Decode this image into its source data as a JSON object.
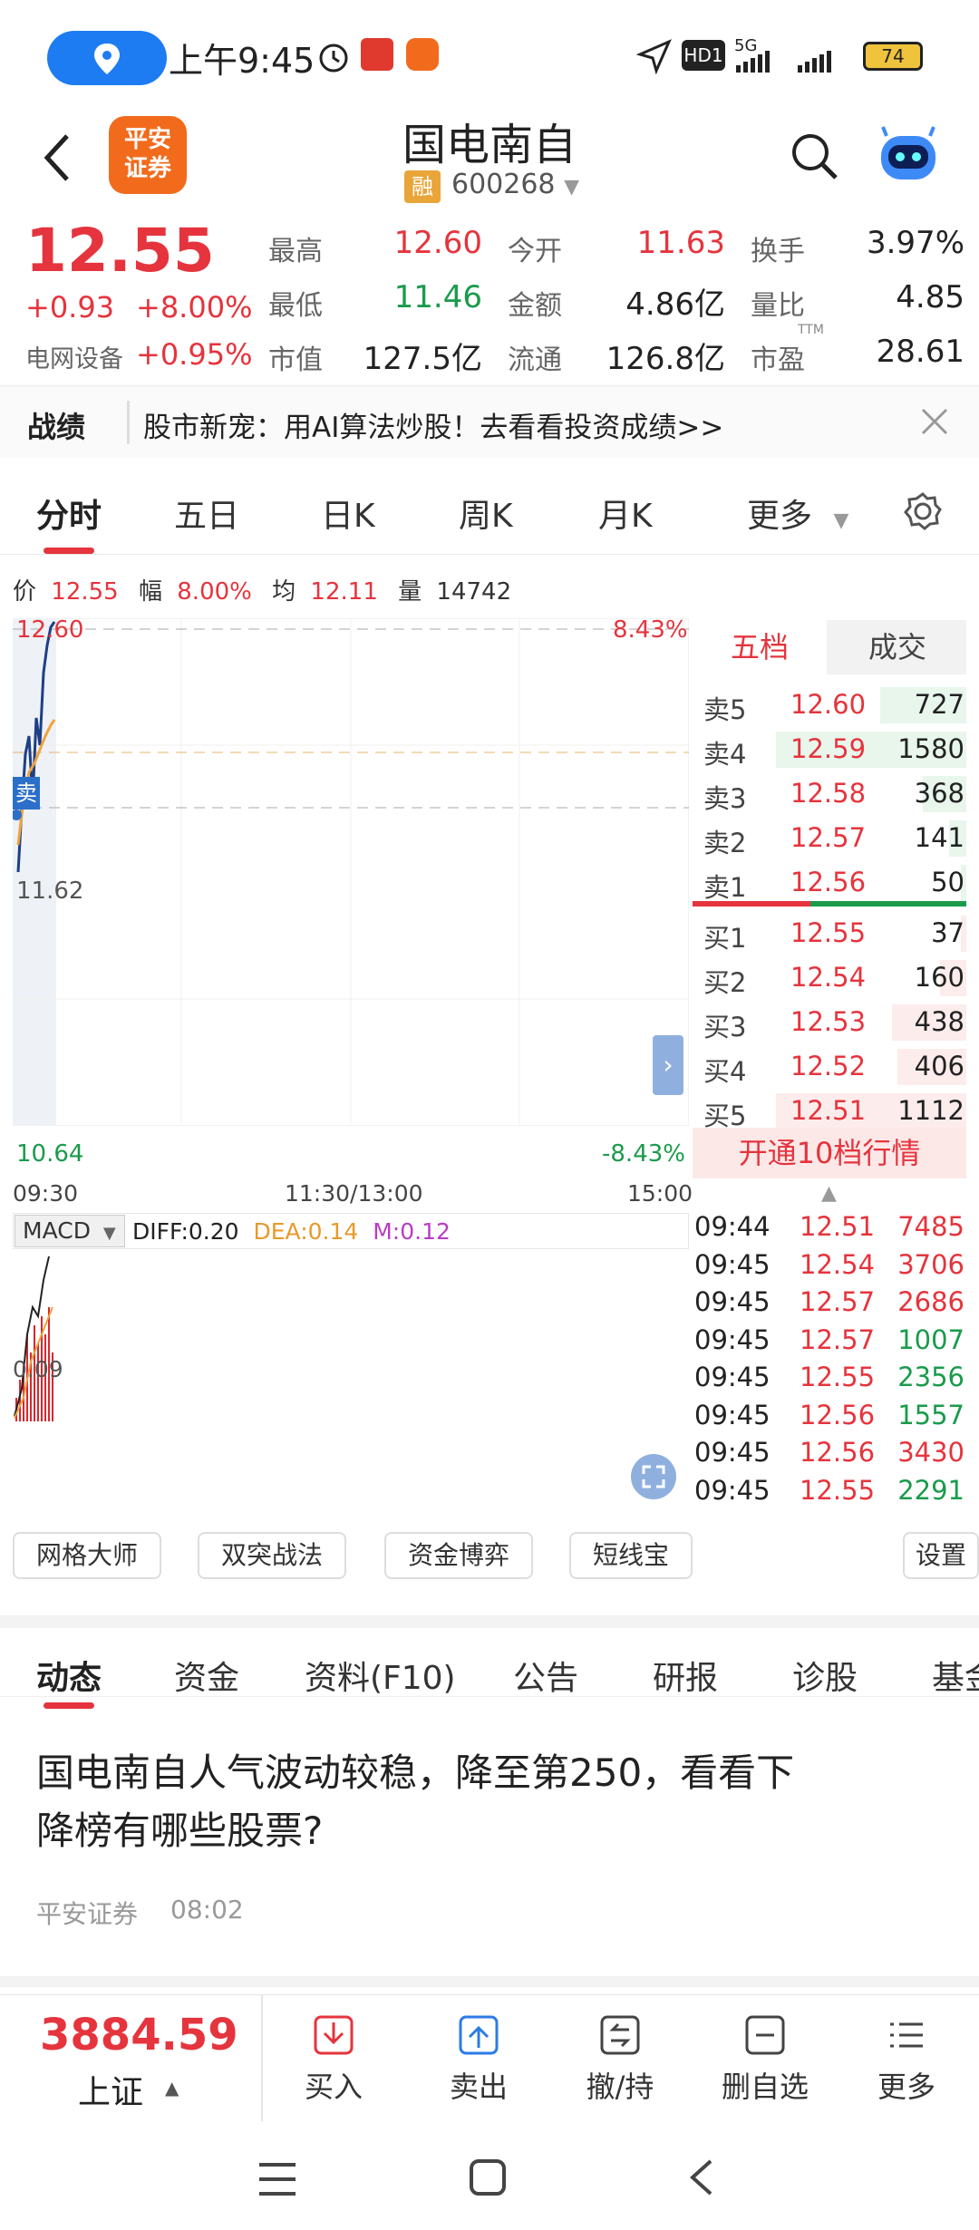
{
  "status_bar": {
    "time": "上午9:45",
    "hd": "HD1",
    "network": "5G",
    "battery": "74"
  },
  "header": {
    "logo_text_line1": "平安",
    "logo_text_line2": "证券",
    "stock_name": "国电南自",
    "margin_badge": "融",
    "stock_code": "600268"
  },
  "quote": {
    "price": "12.55",
    "change": "+0.93",
    "change_pct": "+8.00%",
    "sector": "电网设备",
    "sector_pct": "+0.95%",
    "fields": [
      {
        "label": "最高",
        "value": "12.60",
        "tone": "red"
      },
      {
        "label": "今开",
        "value": "11.63",
        "tone": "red"
      },
      {
        "label": "换手",
        "value": "3.97%",
        "tone": "dark"
      },
      {
        "label": "最低",
        "value": "11.46",
        "tone": "green"
      },
      {
        "label": "金额",
        "value": "4.86亿",
        "tone": "dark"
      },
      {
        "label": "量比",
        "value": "4.85",
        "tone": "dark"
      },
      {
        "label": "市值",
        "value": "127.5亿",
        "tone": "dark"
      },
      {
        "label": "流通",
        "value": "126.8亿",
        "tone": "dark"
      },
      {
        "label": "市盈",
        "value": "28.61",
        "tone": "dark"
      }
    ],
    "ttm": "TTM"
  },
  "banner": {
    "tag": "战绩",
    "text": "股市新宠：用AI算法炒股！去看看投资成绩>>"
  },
  "chart_tabs": [
    "分时",
    "五日",
    "日K",
    "周K",
    "月K",
    "更多"
  ],
  "intraday": {
    "info": {
      "price_label": "价",
      "price": "12.55",
      "range_label": "幅",
      "range": "8.00%",
      "avg_label": "均",
      "avg": "12.11",
      "vol_label": "量",
      "vol": "14742"
    },
    "y_top": "12.60",
    "y_mid": "11.62",
    "y_bottom": "10.64",
    "pct_top": "8.43%",
    "pct_bottom": "-8.43%",
    "sell_tag": "卖",
    "x_start": "09:30",
    "x_mid": "11:30/13:00",
    "x_end": "15:00"
  },
  "macd": {
    "label": "MACD",
    "diff": "DIFF:0.20",
    "dea": "DEA:0.14",
    "m": "M:0.12",
    "level": "0.09"
  },
  "order_book": {
    "tabs": [
      "五档",
      "成交"
    ],
    "asks": [
      {
        "label": "卖5",
        "price": "12.60",
        "vol": "727",
        "fill": 0.45
      },
      {
        "label": "卖4",
        "price": "12.59",
        "vol": "1580",
        "fill": 1.0
      },
      {
        "label": "卖3",
        "price": "12.58",
        "vol": "368",
        "fill": 0.23
      },
      {
        "label": "卖2",
        "price": "12.57",
        "vol": "141",
        "fill": 0.09
      },
      {
        "label": "卖1",
        "price": "12.56",
        "vol": "50",
        "fill": 0.03
      }
    ],
    "bids": [
      {
        "label": "买1",
        "price": "12.55",
        "vol": "37",
        "fill": 0.03
      },
      {
        "label": "买2",
        "price": "12.54",
        "vol": "160",
        "fill": 0.14
      },
      {
        "label": "买3",
        "price": "12.53",
        "vol": "438",
        "fill": 0.39
      },
      {
        "label": "买4",
        "price": "12.52",
        "vol": "406",
        "fill": 0.36
      },
      {
        "label": "买5",
        "price": "12.51",
        "vol": "1112",
        "fill": 1.0
      }
    ],
    "upgrade": "开通10档行情"
  },
  "trades": [
    {
      "time": "09:44",
      "price": "12.51",
      "vol": "7485",
      "tone": "red"
    },
    {
      "time": "09:45",
      "price": "12.54",
      "vol": "3706",
      "tone": "red"
    },
    {
      "time": "09:45",
      "price": "12.57",
      "vol": "2686",
      "tone": "red"
    },
    {
      "time": "09:45",
      "price": "12.57",
      "vol": "1007",
      "tone": "green"
    },
    {
      "time": "09:45",
      "price": "12.55",
      "vol": "2356",
      "tone": "green"
    },
    {
      "time": "09:45",
      "price": "12.56",
      "vol": "1557",
      "tone": "green"
    },
    {
      "time": "09:45",
      "price": "12.56",
      "vol": "3430",
      "tone": "red"
    },
    {
      "time": "09:45",
      "price": "12.55",
      "vol": "2291",
      "tone": "green"
    }
  ],
  "tools": [
    "网格大师",
    "双突战法",
    "资金博弈",
    "短线宝",
    "设置"
  ],
  "news_tabs": [
    "动态",
    "资金",
    "资料(F10)",
    "公告",
    "研报",
    "诊股",
    "基金"
  ],
  "news": {
    "title_line1": "国电南自人气波动较稳，降至第250，看看下",
    "title_line2": "降榜有哪些股票?",
    "source": "平安证券",
    "time": "08:02"
  },
  "bottom_bar": {
    "index_value": "3884.59",
    "index_name": "上证",
    "actions": [
      "买入",
      "卖出",
      "撤/持",
      "删自选",
      "更多"
    ]
  },
  "colors": {
    "up": "#e5343d",
    "down": "#1a9b4b",
    "accent": "#1e7cf2",
    "brand": "#f26b1d"
  }
}
